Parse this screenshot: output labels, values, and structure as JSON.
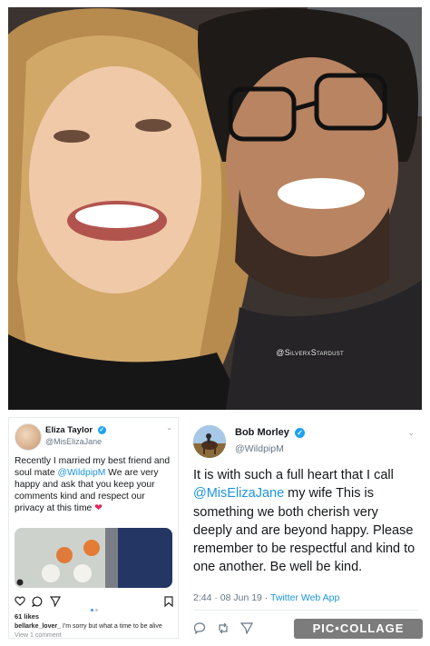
{
  "photo": {
    "watermark": "@SilverxStardust"
  },
  "left_tweet": {
    "name": "Eliza Taylor",
    "handle": "@MisElizaJane",
    "verified_symbol": "✓",
    "text_before_mention": "Recently I married my best friend and soul mate ",
    "mention": "@WildpipM",
    "text_after_mention": " We are very happy and ask that you keep your comments kind and respect our privacy at this time",
    "heart": "❤",
    "caret": "⌄",
    "instagram": {
      "likes": "61 likes",
      "comment_user": "bellarke_lover_",
      "comment_text": " I'm sorry but what a time to be alive",
      "comment_more": "View 1 comment"
    }
  },
  "right_tweet": {
    "name": "Bob Morley",
    "handle": "@WildpipM",
    "verified_symbol": "✓",
    "caret": "⌄",
    "text_before_mention": "It is with such a full heart that I call ",
    "mention": "@MisElizaJane",
    "text_after_mention": " my wife This is something we both cherish very deeply and are beyond happy. Please remember to be respectful and kind to one another. Be well be kind.",
    "timestamp": "2:44 · 08 Jun 19 · ",
    "client": "Twitter Web App"
  },
  "watermark": {
    "text": "PIC•COLLAGE"
  },
  "colors": {
    "twitter_blue": "#1da1f2",
    "mention_blue": "#1b95e0",
    "heart_red": "#e0245e"
  }
}
